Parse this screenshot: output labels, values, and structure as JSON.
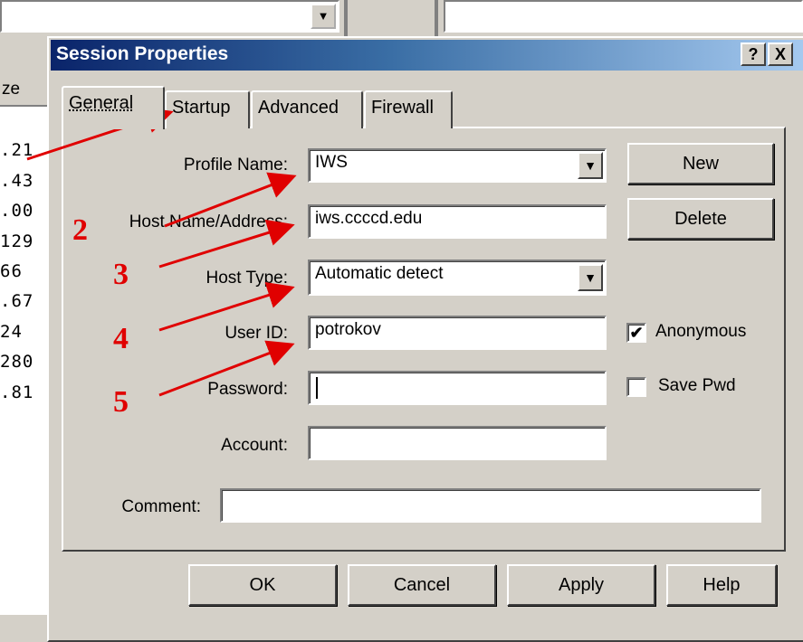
{
  "background": {
    "column_header": "ze",
    "column_values": [
      ".21",
      ".43",
      ".00",
      "129",
      "66",
      ".67",
      "24",
      "280",
      ".81"
    ]
  },
  "dialog": {
    "title": "Session Properties",
    "help_button": "?",
    "close_button": "X",
    "tabs": [
      {
        "label": "General",
        "active": true
      },
      {
        "label": "Startup",
        "active": false
      },
      {
        "label": "Advanced",
        "active": false
      },
      {
        "label": "Firewall",
        "active": false
      }
    ],
    "fields": {
      "profile_name": {
        "label": "Profile Name:",
        "value": "IWS"
      },
      "host_name": {
        "label": "Host Name/Address:",
        "value": "iws.ccccd.edu"
      },
      "host_type": {
        "label": "Host Type:",
        "value": "Automatic detect"
      },
      "user_id": {
        "label": "User ID:",
        "value": "potrokov"
      },
      "password": {
        "label": "Password:",
        "value": ""
      },
      "account": {
        "label": "Account:",
        "value": ""
      },
      "comment": {
        "label": "Comment:",
        "value": ""
      }
    },
    "side_buttons": {
      "new": "New",
      "delete": "Delete"
    },
    "checkboxes": {
      "anonymous": {
        "label": "Anonymous",
        "checked": true
      },
      "save_pwd": {
        "label": "Save Pwd",
        "checked": false
      }
    },
    "footer_buttons": {
      "ok": "OK",
      "cancel": "Cancel",
      "apply": "Apply",
      "help": "Help"
    }
  },
  "annotations": {
    "numbers": [
      "2",
      "3",
      "4",
      "5"
    ],
    "color": "#e00000"
  },
  "icons": {
    "dropdown": "chevron-down-icon",
    "checkmark": "checkmark-icon"
  },
  "colors": {
    "titlebar_start": "#0a246a",
    "titlebar_end": "#a6caf0",
    "face": "#d4d0c8",
    "annotation": "#e00000"
  }
}
